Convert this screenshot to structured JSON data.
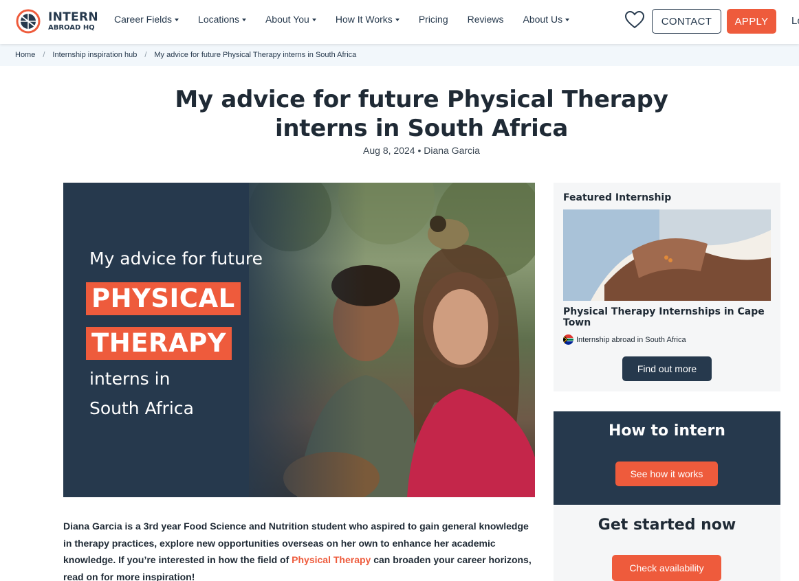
{
  "header": {
    "logo_line1": "INTERN",
    "logo_line2": "ABROAD HQ",
    "nav": [
      {
        "label": "Career Fields",
        "dropdown": true
      },
      {
        "label": "Locations",
        "dropdown": true
      },
      {
        "label": "About You",
        "dropdown": true
      },
      {
        "label": "How It Works",
        "dropdown": true
      },
      {
        "label": "Pricing",
        "dropdown": false
      },
      {
        "label": "Reviews",
        "dropdown": false
      },
      {
        "label": "About Us",
        "dropdown": true
      }
    ],
    "contact_label": "CONTACT",
    "apply_label": "APPLY",
    "login_partial": "Lo"
  },
  "breadcrumb": {
    "items": [
      "Home",
      "Internship inspiration hub",
      "My advice for future Physical Therapy interns in South Africa"
    ],
    "separator": "/"
  },
  "article": {
    "title_line1": "My advice for future Physical Therapy",
    "title_line2": "interns in South Africa",
    "meta": "Aug 8, 2024 • Diana Garcia",
    "hero": {
      "line1": "My advice for future",
      "box1": "PHYSICAL",
      "box2": "THERAPY",
      "line3": "interns in",
      "line4": "South Africa"
    },
    "intro_before": "Diana Garcia is a 3rd year Food Science and Nutrition student who aspired to gain general knowledge in therapy practices, explore new opportunities overseas on her own to enhance her academic knowledge. If you’re interested in how the field of ",
    "intro_link": "Physical Therapy",
    "intro_after": " can broaden your career horizons, read on for more inspiration!"
  },
  "sidebar": {
    "featured_heading": "Featured Internship",
    "featured_title": "Physical Therapy Internships in Cape Town",
    "featured_location": "Internship abroad in South Africa",
    "find_out_label": "Find out more",
    "how_heading": "How to intern",
    "how_button": "See how it works",
    "start_heading": "Get started now",
    "start_button": "Check availability"
  },
  "colors": {
    "brand_navy": "#26394d",
    "brand_orange": "#ee5b3c",
    "breadcrumb_bg": "#f2f7fb",
    "sidebar_bg": "#f5f6f7"
  },
  "icons": {
    "logo": "globe-logo-icon",
    "wishlist": "heart-icon",
    "flag": "south-africa-flag-icon",
    "caret": "caret-down-icon"
  }
}
